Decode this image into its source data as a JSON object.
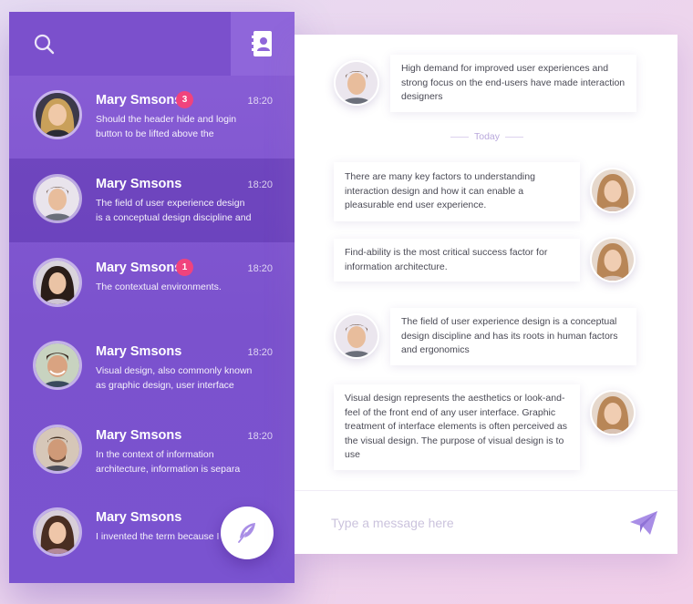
{
  "sidebar": {
    "conversations": [
      {
        "name": "Mary Smsons",
        "badge": "3",
        "time": "18:20",
        "preview": "Should the header hide and login button to be lifted above the"
      },
      {
        "name": "Mary Smsons",
        "badge": "",
        "time": "18:20",
        "preview": "The field of user experience design is a conceptual design discipline and"
      },
      {
        "name": "Mary Smsons",
        "badge": "1",
        "time": "18:20",
        "preview": "The contextual environments."
      },
      {
        "name": "Mary Smsons",
        "badge": "",
        "time": "18:20",
        "preview": "Visual design, also commonly known as graphic design, user interface"
      },
      {
        "name": "Mary Smsons",
        "badge": "",
        "time": "18:20",
        "preview": "In the context of information architecture, information is separa"
      },
      {
        "name": "Mary Smsons",
        "badge": "",
        "time": "",
        "preview": "I invented the term because I"
      }
    ]
  },
  "chat": {
    "messages": [
      {
        "from": "other",
        "text": "High demand for improved user experiences and strong focus on the end-users have made interaction designers"
      },
      {
        "from": "me",
        "text": "There are many key factors to understanding interaction design and how it can enable a pleasurable end user experience."
      },
      {
        "from": "me",
        "text": "Find-ability is the most critical success factor for information architecture."
      },
      {
        "from": "other",
        "text": "The field of user experience design is a conceptual design discipline and has its roots in human factors and ergonomics"
      },
      {
        "from": "me",
        "text": "Visual design  represents the aesthetics or look-and-feel of the front end of any user interface. Graphic treatment of interface elements is often perceived as the visual design. The purpose of visual design is to use"
      }
    ],
    "divider_label": "Today",
    "composer": {
      "placeholder": "Type a message here",
      "value": ""
    }
  },
  "icons": {
    "search": "search-icon",
    "contacts": "address-book-icon",
    "compose": "feather-icon",
    "send": "paper-plane-icon"
  },
  "colors": {
    "sidebar": "#7b52cd",
    "active_row": "#6a43bd",
    "badge": "#f0437d",
    "accent": "#a88be0",
    "divider_text": "#b9a8dc"
  }
}
